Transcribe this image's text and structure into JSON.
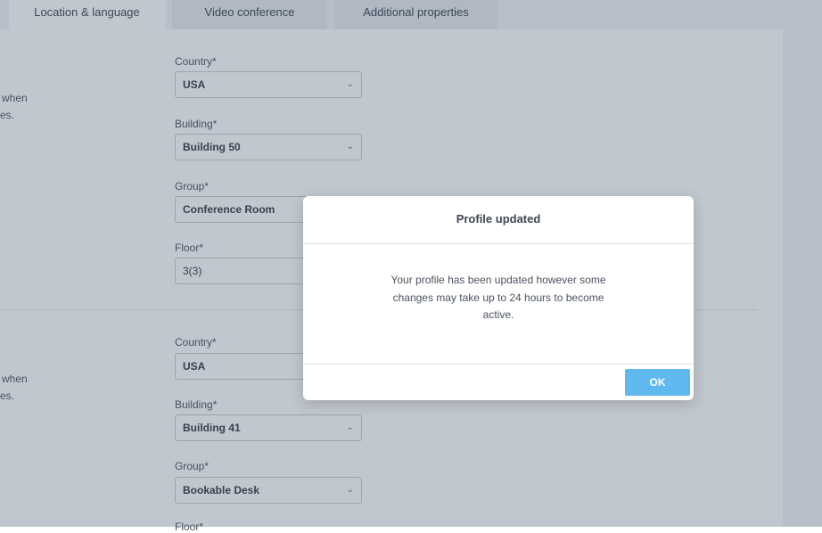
{
  "tabs": [
    {
      "label": "Location & language",
      "active": true
    },
    {
      "label": "Video conference",
      "active": false
    },
    {
      "label": "Additional properties",
      "active": false
    }
  ],
  "section1": {
    "side_text_lines": [
      "when",
      "es."
    ],
    "fields": [
      {
        "label": "Country*",
        "value": "USA"
      },
      {
        "label": "Building*",
        "value": "Building 50"
      },
      {
        "label": "Group*",
        "value": "Conference Room"
      },
      {
        "label": "Floor*",
        "value": "3(3)"
      }
    ]
  },
  "section2": {
    "side_text_lines": [
      "when",
      "es."
    ],
    "fields": [
      {
        "label": "Country*",
        "value": "USA"
      },
      {
        "label": "Building*",
        "value": "Building 41"
      },
      {
        "label": "Group*",
        "value": "Bookable Desk"
      },
      {
        "label": "Floor*",
        "value": ""
      }
    ]
  },
  "icons": {
    "dropdown": "chevron-down-icon"
  },
  "modal": {
    "title": "Profile updated",
    "message_lines": [
      "Your profile has been updated however some",
      "changes may take up to 24 hours to become",
      "active."
    ],
    "ok_label": "OK"
  },
  "colors": {
    "primary_button": "#5fb8ee",
    "overlay": "#3e5068"
  }
}
